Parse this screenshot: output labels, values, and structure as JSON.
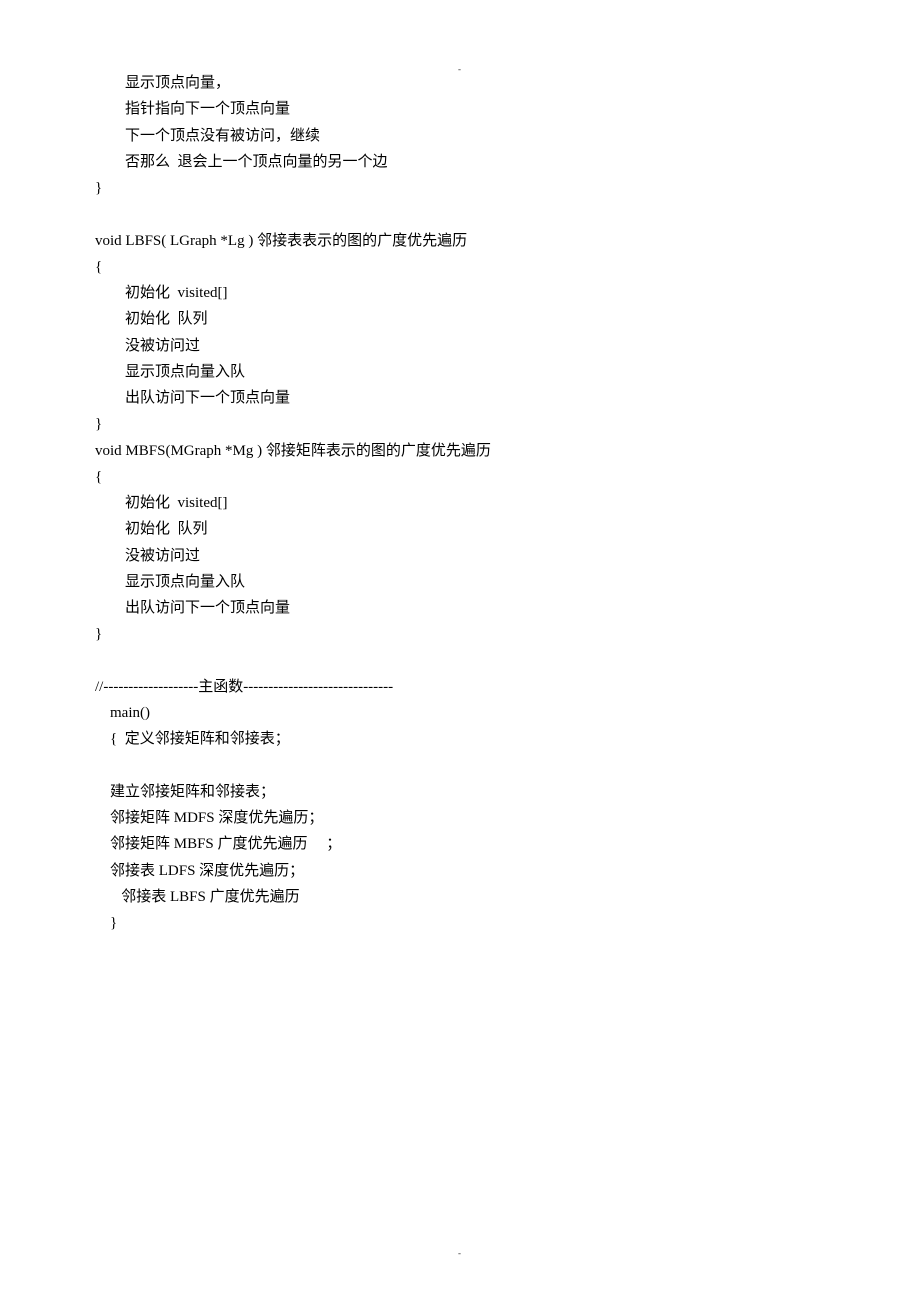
{
  "marker_top": "-",
  "marker_bottom": "-",
  "lines": [
    "        显示顶点向量，",
    "        指针指向下一个顶点向量",
    "        下一个顶点没有被访问，继续",
    "        否那么  退会上一个顶点向量的另一个边",
    "}",
    "",
    "void LBFS( LGraph *Lg ) 邻接表表示的图的广度优先遍历",
    "{",
    "        初始化  visited[]",
    "        初始化  队列",
    "        没被访问过",
    "        显示顶点向量入队",
    "        出队访问下一个顶点向量",
    "}",
    "void MBFS(MGraph *Mg ) 邻接矩阵表示的图的广度优先遍历",
    "{",
    "        初始化  visited[]",
    "        初始化  队列",
    "        没被访问过",
    "        显示顶点向量入队",
    "        出队访问下一个顶点向量",
    "}",
    "",
    "//-------------------主函数------------------------------",
    "    main()",
    "    {  定义邻接矩阵和邻接表；",
    "",
    "    建立邻接矩阵和邻接表；",
    "    邻接矩阵 MDFS 深度优先遍历；",
    "    邻接矩阵 MBFS 广度优先遍历     ；",
    "    邻接表 LDFS 深度优先遍历；",
    "       邻接表 LBFS 广度优先遍历",
    "    }"
  ]
}
